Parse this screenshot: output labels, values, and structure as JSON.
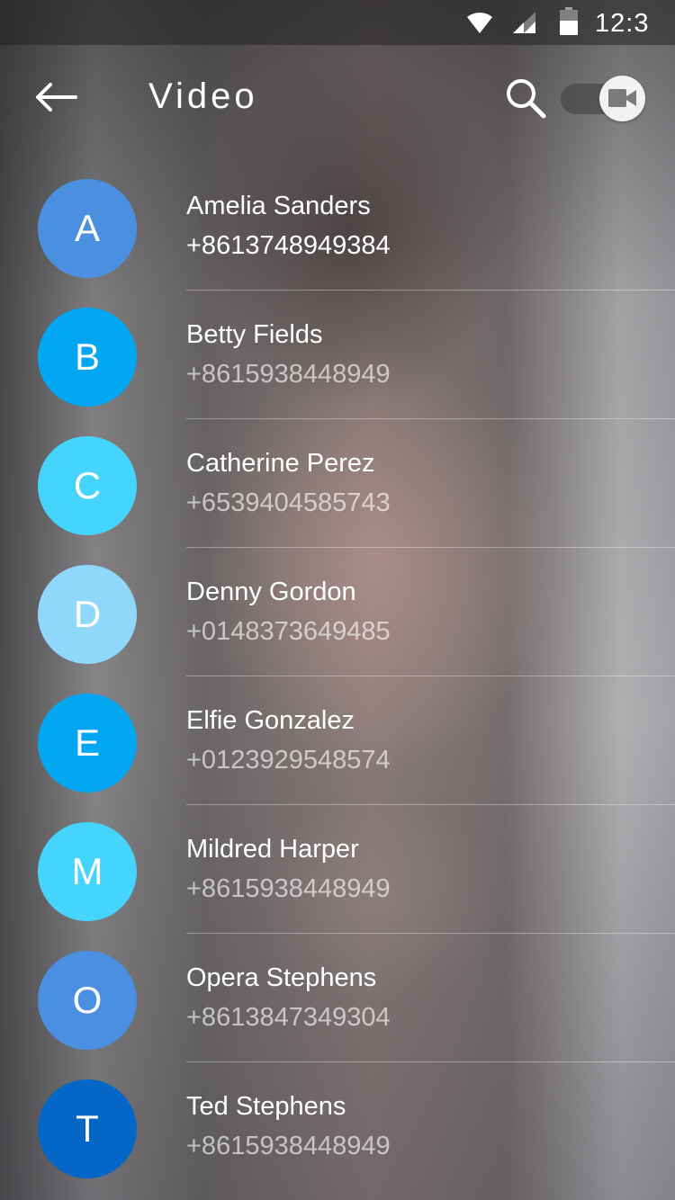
{
  "status_bar": {
    "time": "12:3",
    "icons": [
      "wifi-icon",
      "cell-signal-icon",
      "battery-icon"
    ]
  },
  "app_bar": {
    "title": "Video",
    "back_icon": "arrow-left-icon",
    "search_icon": "search-icon",
    "toggle_icon": "video-camera-icon",
    "video_toggle_on": true
  },
  "contacts": [
    {
      "initial": "A",
      "name": "Amelia Sanders",
      "phone": "+8613748949384",
      "color": "#4a8fe0"
    },
    {
      "initial": "B",
      "name": "Betty Fields",
      "phone": "+8615938448949",
      "color": "#03a6f0"
    },
    {
      "initial": "C",
      "name": "Catherine Perez",
      "phone": "+6539404585743",
      "color": "#45d4fb"
    },
    {
      "initial": "D",
      "name": "Denny Gordon",
      "phone": "+0148373649485",
      "color": "#8fd8fb"
    },
    {
      "initial": "E",
      "name": "Elfie Gonzalez",
      "phone": "+0123929548574",
      "color": "#03a6f0"
    },
    {
      "initial": "M",
      "name": "Mildred Harper",
      "phone": "+8615938448949",
      "color": "#45d4fb"
    },
    {
      "initial": "O",
      "name": "Opera Stephens",
      "phone": "+8613847349304",
      "color": "#4a8fe0"
    },
    {
      "initial": "T",
      "name": "Ted Stephens",
      "phone": "+8615938448949",
      "color": "#0467c7"
    }
  ],
  "colors": {
    "divider": "#ffffff",
    "text_primary": "#ffffff"
  }
}
